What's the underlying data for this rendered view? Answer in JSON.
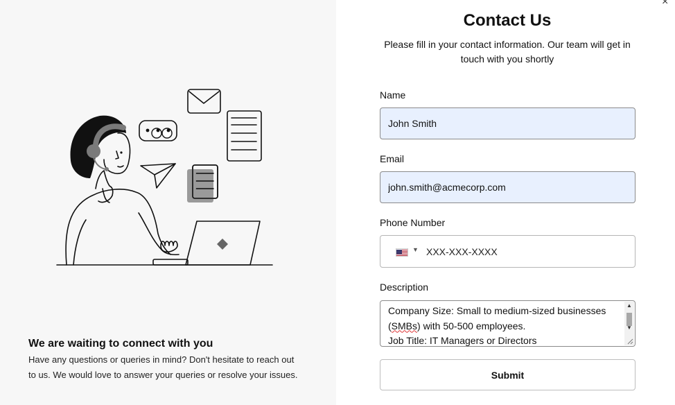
{
  "left": {
    "heading": "We are waiting to connect with you",
    "text": "Have any questions or queries in mind? Don't hesitate to reach out to us. We would love to answer your queries or resolve your issues."
  },
  "form": {
    "title": "Contact Us",
    "subtitle": "Please fill in your contact information. Our team will get in touch with you shortly",
    "close_label": "×",
    "name": {
      "label": "Name",
      "value": "John Smith"
    },
    "email": {
      "label": "Email",
      "value": "john.smith@acmecorp.com"
    },
    "phone": {
      "label": "Phone Number",
      "placeholder": "XXX-XXX-XXXX",
      "country_icon": "us-flag-icon"
    },
    "description": {
      "label": "Description",
      "line1": "Company Size: Small to medium-sized businesses",
      "line2_prefix": "(",
      "line2_misspelled": "SMBs",
      "line2_suffix": ") with 50-500 employees.",
      "line3": "Job Title: IT Managers or Directors"
    },
    "submit_label": "Submit"
  },
  "colors": {
    "left_background": "#f7f7f7",
    "autofill_background": "#e8f0fe",
    "border": "#8a8a8a"
  }
}
